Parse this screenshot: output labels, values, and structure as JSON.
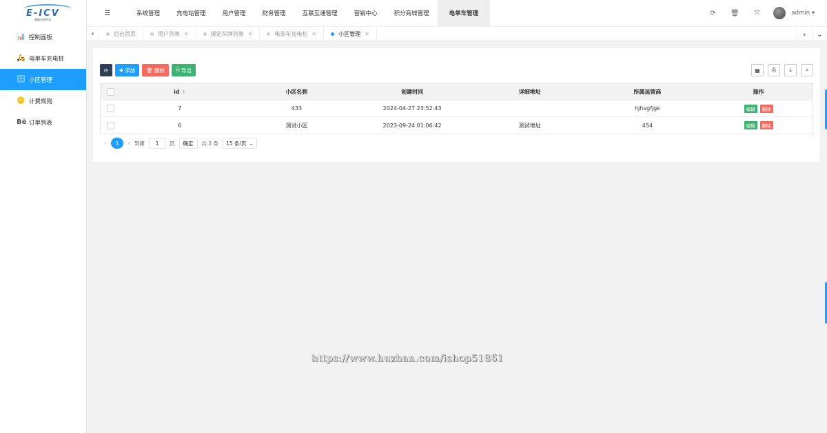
{
  "logo": {
    "text": "E-ICV",
    "subtitle": "易能充电平台"
  },
  "sidebar": {
    "items": [
      {
        "icon": "📊",
        "label": "控制面板"
      },
      {
        "icon": "🛵",
        "label": "电单车充电桩"
      },
      {
        "icon": "🗄",
        "label": "小区管理",
        "active": true
      },
      {
        "icon": "🪙",
        "label": "计费规则"
      },
      {
        "icon": "Bē",
        "label": "订单列表"
      }
    ]
  },
  "topbar": {
    "menu": [
      "系统管理",
      "充电站管理",
      "用户管理",
      "财务管理",
      "互联互通管理",
      "营销中心",
      "积分商城管理",
      "电单车管理"
    ],
    "active_index": 7,
    "user": "admin ▾"
  },
  "tabs": [
    {
      "label": "后台首页",
      "closable": false
    },
    {
      "label": "用户列表",
      "closable": true
    },
    {
      "label": "绑定车牌列表",
      "closable": true
    },
    {
      "label": "电单车充电桩",
      "closable": true
    },
    {
      "label": "小区管理",
      "closable": true,
      "active": true
    }
  ],
  "toolbar": {
    "add": "添加",
    "delete": "删除",
    "export": "导出"
  },
  "table": {
    "headers": [
      "id",
      "小区名称",
      "创建时间",
      "详细地址",
      "所属运营商",
      "操作"
    ],
    "rows": [
      {
        "id": "7",
        "name": "433",
        "created": "2024-04-27 23:52:43",
        "address": "",
        "operator": "hjhvgfjgk"
      },
      {
        "id": "6",
        "name": "测试小区",
        "created": "2023-09-24 01:06:42",
        "address": "测试地址",
        "operator": "454"
      }
    ],
    "edit_label": "编辑",
    "delete_label": "删除"
  },
  "pager": {
    "current": "1",
    "goto_label": "到第",
    "page_input": "1",
    "page_unit": "页",
    "confirm": "确定",
    "total": "共 2 条",
    "page_size": "15 条/页"
  },
  "watermark": "https://www.huzhan.com/ishop51861",
  "colors": {
    "accent": "#1e9fff",
    "danger": "#f46a5e",
    "success": "#3cb371",
    "dark": "#2f4056"
  }
}
